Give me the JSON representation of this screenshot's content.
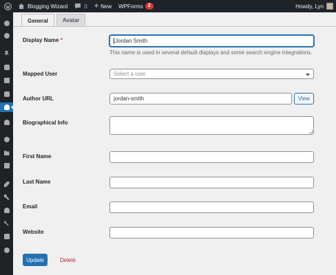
{
  "admin_bar": {
    "site_name": "Blogging Wizard",
    "comments_count": "0",
    "new_label": "New",
    "plugin_label": "WPForms",
    "plugin_badge": "2",
    "howdy": "Howdy, Lyn"
  },
  "sidebar": {
    "items": [
      {
        "icon": "dashboard-icon"
      },
      {
        "icon": "jetpack-icon"
      },
      {
        "icon": "posts-pin-icon"
      },
      {
        "icon": "media-icon"
      },
      {
        "icon": "pages-icon"
      },
      {
        "icon": "comments-icon"
      },
      {
        "icon": "authors-icon",
        "active": true
      },
      {
        "icon": "users-group-icon"
      },
      {
        "icon": "globe-icon"
      },
      {
        "icon": "folder-icon"
      },
      {
        "icon": "forms-icon"
      },
      {
        "icon": "appearance-brush-icon"
      },
      {
        "icon": "plugins-icon"
      },
      {
        "icon": "users-icon"
      },
      {
        "icon": "tools-icon"
      },
      {
        "icon": "settings-icon"
      },
      {
        "icon": "collapse-icon"
      }
    ]
  },
  "tabs": [
    "General",
    "Avatar"
  ],
  "form": {
    "display_name": {
      "label": "Display Name",
      "required_mark": "*",
      "value": "Jordan Smith",
      "description": "This name is used in several default displays and some search engine integrations."
    },
    "mapped_user": {
      "label": "Mapped User",
      "placeholder": "Select a user"
    },
    "author_url": {
      "label": "Author URL",
      "value": "jordan-smith",
      "view_button": "View"
    },
    "bio": {
      "label": "Biographical Info",
      "value": ""
    },
    "first_name": {
      "label": "First Name",
      "value": ""
    },
    "last_name": {
      "label": "Last Name",
      "value": ""
    },
    "email": {
      "label": "Email",
      "value": ""
    },
    "website": {
      "label": "Website",
      "value": ""
    }
  },
  "actions": {
    "update": "Update",
    "delete": "Delete"
  },
  "colors": {
    "admin_bar": "#1d2327",
    "accent": "#2271b1",
    "danger": "#d63638",
    "background": "#f0f0f1"
  }
}
